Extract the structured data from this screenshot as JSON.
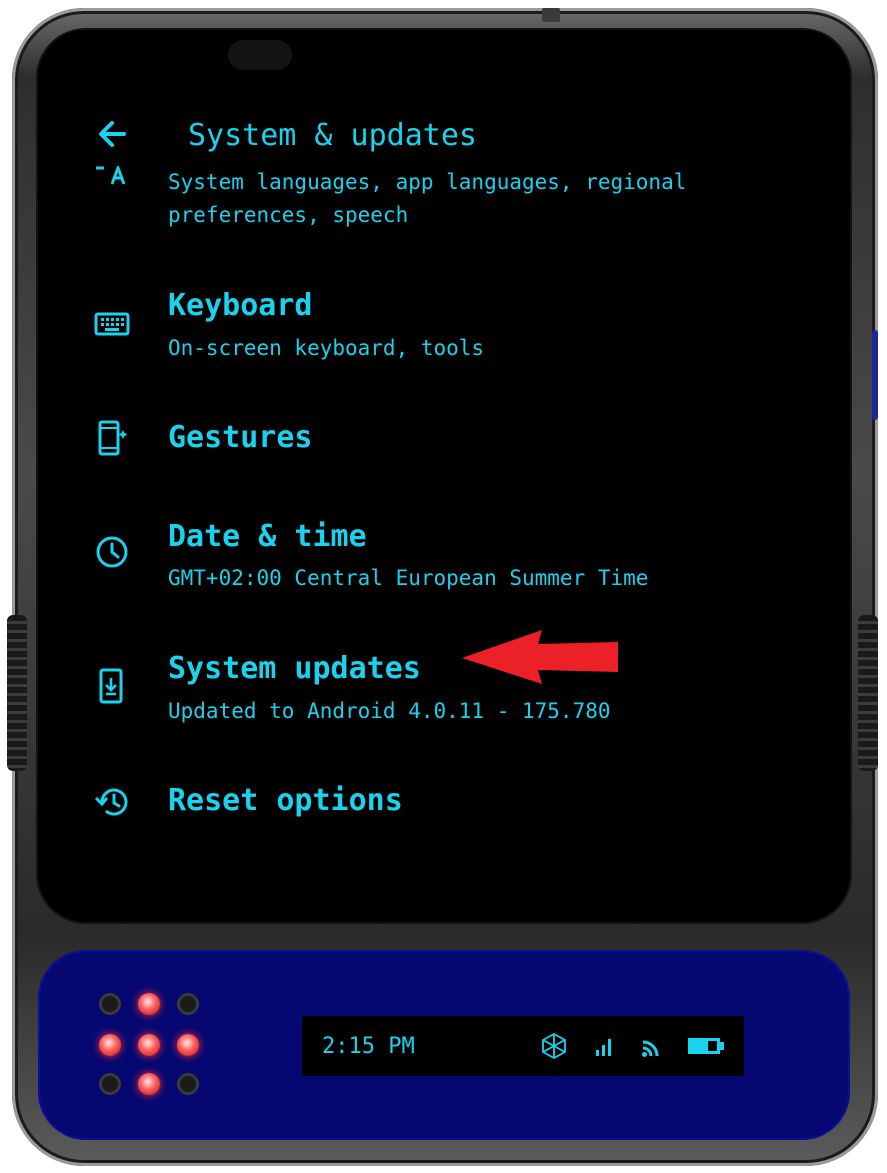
{
  "header": {
    "title": "System & updates",
    "back_icon": "arrow-left-icon"
  },
  "items": [
    {
      "icon": "translate-icon",
      "title": "",
      "subtitle_line1": "System languages, app languages, regional",
      "subtitle_line2": "preferences, speech"
    },
    {
      "icon": "keyboard-icon",
      "title": "Keyboard",
      "subtitle": "On-screen keyboard, tools"
    },
    {
      "icon": "gestures-phone-icon",
      "title": "Gestures",
      "subtitle": ""
    },
    {
      "icon": "clock-icon",
      "title": "Date & time",
      "subtitle": "GMT+02:00 Central European Summer Time"
    },
    {
      "icon": "system-update-icon",
      "title": "System updates",
      "subtitle": "Updated to Android 4.0.11 - 175.780"
    },
    {
      "icon": "history-icon",
      "title": "Reset options",
      "subtitle": ""
    }
  ],
  "status_bar": {
    "time": "2:15 PM",
    "icons": [
      "cube-icon",
      "signal-bars-icon",
      "wifi-icon",
      "battery-icon"
    ]
  },
  "colors": {
    "accent": "#18d2ee",
    "screen_bg": "#000000",
    "bottom_panel": "#060872",
    "annotation_arrow": "#ec2027",
    "led_on": "#ff4040"
  },
  "annotation": {
    "arrow_target": "system-updates-item"
  },
  "led_grid": [
    0,
    1,
    0,
    1,
    1,
    1,
    0,
    1,
    0
  ]
}
